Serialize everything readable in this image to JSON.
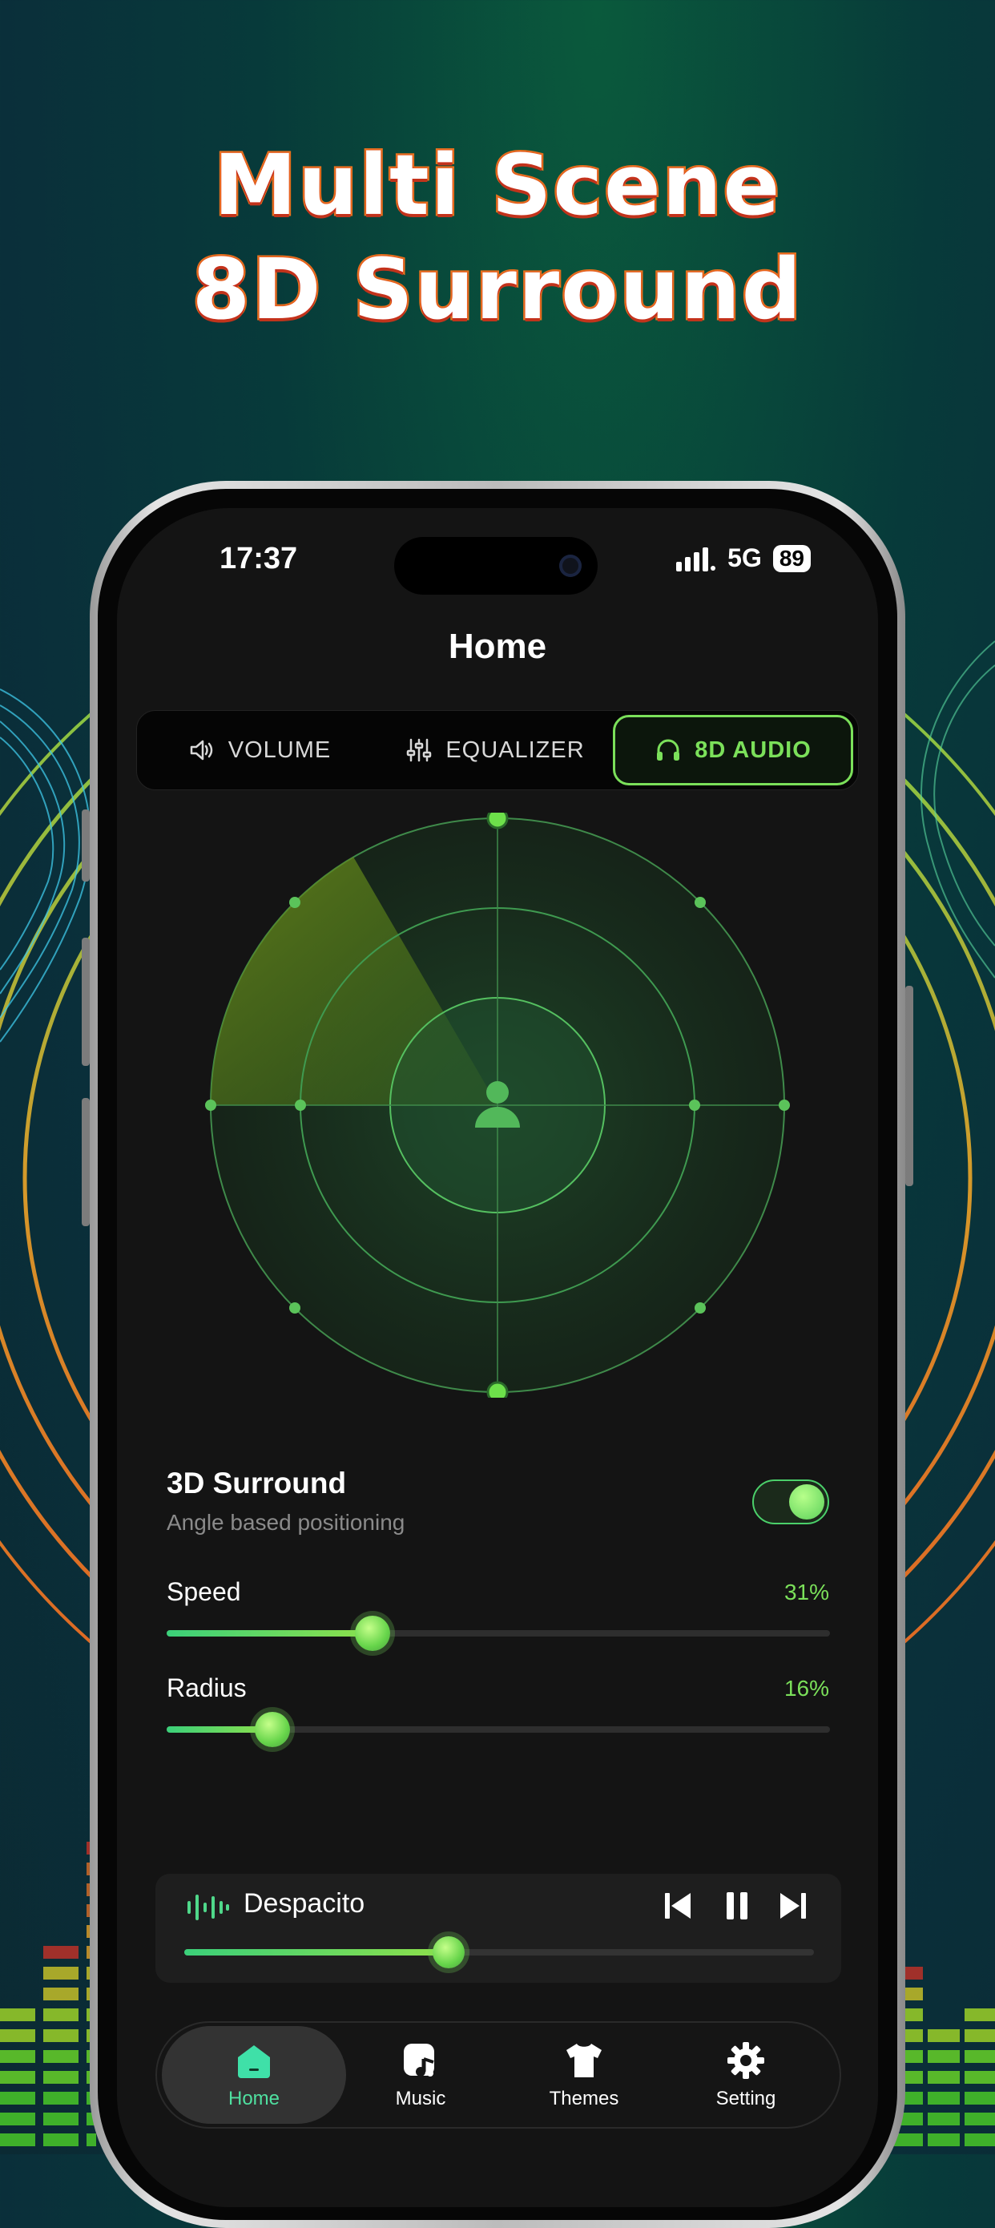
{
  "headline": {
    "line1": "Multi Scene",
    "line2": "8D Surround"
  },
  "status_bar": {
    "time": "17:37",
    "network": "5G",
    "battery": "89"
  },
  "header": {
    "title": "Home"
  },
  "tabs": [
    {
      "label": "VOLUME",
      "icon": "speaker-icon",
      "active": false
    },
    {
      "label": "EQUALIZER",
      "icon": "equalizer-icon",
      "active": false
    },
    {
      "label": "8D AUDIO",
      "icon": "headphones-icon",
      "active": true
    }
  ],
  "surround": {
    "title": "3D Surround",
    "subtitle": "Angle based positioning",
    "enabled": true
  },
  "sliders": {
    "speed": {
      "label": "Speed",
      "value_text": "31%",
      "value": 0.31
    },
    "radius": {
      "label": "Radius",
      "value_text": "16%",
      "value": 0.16
    }
  },
  "player": {
    "song": "Despacito",
    "progress": 0.42
  },
  "nav": [
    {
      "label": "Home",
      "icon": "home-icon",
      "active": true
    },
    {
      "label": "Music",
      "icon": "music-icon",
      "active": false
    },
    {
      "label": "Themes",
      "icon": "shirt-icon",
      "active": false
    },
    {
      "label": "Setting",
      "icon": "gear-icon",
      "active": false
    }
  ],
  "colors": {
    "accent": "#7be05a",
    "nav_active": "#4fe0a0",
    "screen_bg": "#141414"
  }
}
